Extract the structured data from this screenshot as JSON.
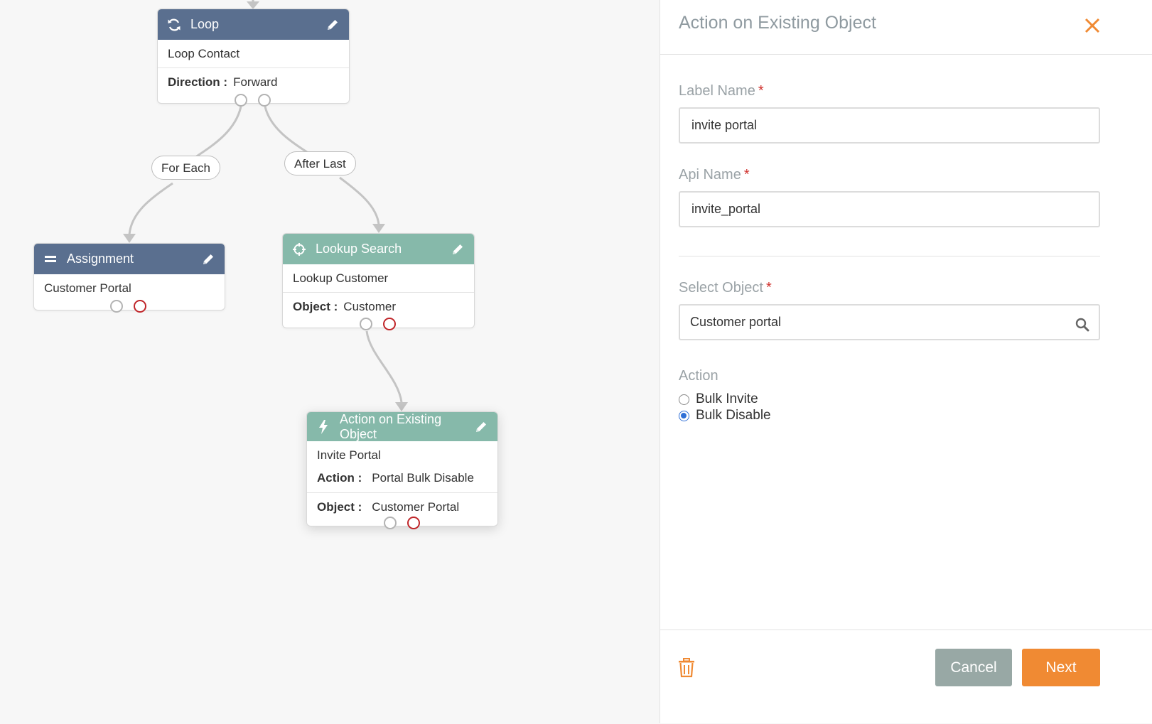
{
  "canvas": {
    "nodes": {
      "loop": {
        "title": "Loop",
        "icon": "refresh-icon",
        "subtitle": "Loop Contact",
        "field_key": "Direction :",
        "field_value": "Forward"
      },
      "assignment": {
        "title": "Assignment",
        "icon": "equals-icon",
        "subtitle": "Customer Portal"
      },
      "lookup": {
        "title": "Lookup Search",
        "icon": "crosshair-icon",
        "subtitle": "Lookup Customer",
        "field_key": "Object :",
        "field_value": "Customer"
      },
      "action": {
        "title": "Action on Existing Object",
        "icon": "bolt-icon",
        "subtitle": "Invite Portal",
        "action_key": "Action :",
        "action_value": "Portal Bulk Disable",
        "field_key": "Object :",
        "field_value": "Customer Portal"
      }
    },
    "edge_labels": {
      "for_each": "For Each",
      "after_last": "After Last"
    }
  },
  "panel": {
    "title": "Action on Existing Object",
    "label_name": {
      "label": "Label Name",
      "required": "*",
      "value": "invite portal"
    },
    "api_name": {
      "label": "Api Name",
      "required": "*",
      "value": "invite_portal"
    },
    "select_object": {
      "label": "Select Object",
      "required": "*",
      "value": "Customer portal"
    },
    "action": {
      "label": "Action",
      "options": [
        "Bulk Invite",
        "Bulk Disable"
      ],
      "selected": "Bulk Disable"
    },
    "buttons": {
      "cancel": "Cancel",
      "next": "Next"
    }
  },
  "colors": {
    "slate_header": "#5a6f8f",
    "teal_header": "#86b9aa",
    "accent_orange": "#f08a33",
    "cancel_gray": "#98a8a5",
    "required_red": "#d0312d"
  }
}
